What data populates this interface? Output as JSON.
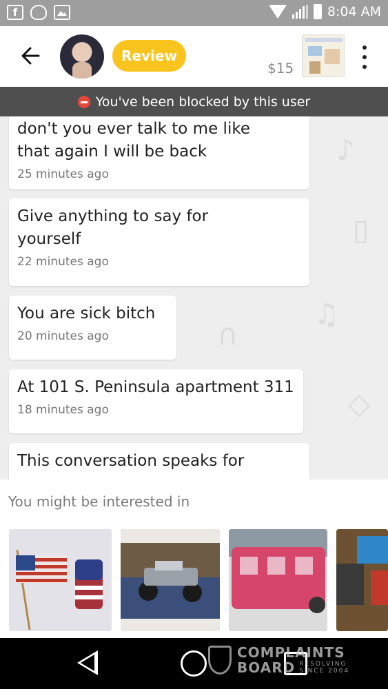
{
  "status_bar": {
    "time": "8:04 AM",
    "left_icons": [
      "facebook-icon",
      "snapchat-icon",
      "gallery-icon"
    ],
    "right_icons": [
      "wifi-icon",
      "signal-icon",
      "battery-icon"
    ]
  },
  "header": {
    "review_label": "Review",
    "price": "$15",
    "accent_color": "#f9c41e"
  },
  "banner": {
    "text": "You've been blocked by this user",
    "background": "#4f4f4f"
  },
  "messages": [
    {
      "text_lines": [
        "don't you ever talk to me like",
        "that again I will be back"
      ],
      "time": "25 minutes ago"
    },
    {
      "text_lines": [
        "Give anything to say for",
        "yourself"
      ],
      "time": "22 minutes ago"
    },
    {
      "text_lines": [
        "You are sick bitch"
      ],
      "time": "20 minutes ago"
    },
    {
      "text_lines": [
        "At 101 S. Peninsula apartment 311"
      ],
      "time": "18 minutes ago"
    },
    {
      "text_lines": [
        "This conversation speaks for"
      ],
      "time": ""
    }
  ],
  "suggestions": {
    "title": "You might be interested in",
    "items": [
      "american-flag-cup-photo",
      "rc-monster-truck-photo",
      "pink-toy-bus-photo",
      "blue-item-photo"
    ]
  },
  "watermark": {
    "line1": "COMPLAINTS",
    "line2": "BOARD",
    "tag1": "RESOLVING",
    "tag2": "SINCE 2004"
  }
}
